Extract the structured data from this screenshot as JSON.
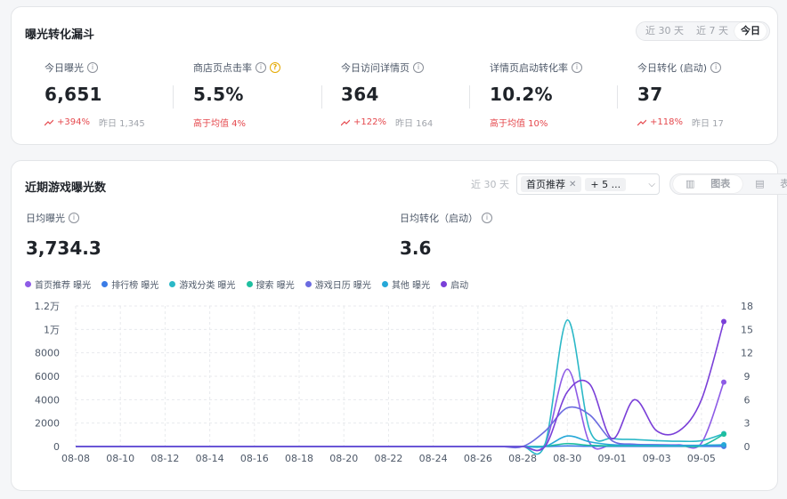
{
  "funnel": {
    "title": "曝光转化漏斗",
    "ranges": [
      "近 30 天",
      "近 7 天",
      "今日"
    ],
    "active_range": 2,
    "kpis": [
      {
        "label": "今日曝光",
        "value": "6,651",
        "change": "+394%",
        "compare": "昨日 1,345",
        "help": false
      },
      {
        "label": "商店页点击率",
        "value": "5.5%",
        "change": "高于均值 4%",
        "compare": "",
        "help": true
      },
      {
        "label": "今日访问详情页",
        "value": "364",
        "change": "+122%",
        "compare": "昨日 164",
        "help": false
      },
      {
        "label": "详情页启动转化率",
        "value": "10.2%",
        "change": "高于均值 10%",
        "compare": "",
        "help": false
      },
      {
        "label": "今日转化 (启动)",
        "value": "37",
        "change": "+118%",
        "compare": "昨日 17",
        "help": false
      }
    ]
  },
  "trend": {
    "title": "近期游戏曝光数",
    "range_label": "近 30 天",
    "filter_chip": "首页推荐",
    "filter_more": "+ 5 ...",
    "view_chart": "图表",
    "view_table": "表格",
    "avg_exposure_label": "日均曝光",
    "avg_exposure_value": "3,734.3",
    "avg_conv_label": "日均转化（启动）",
    "avg_conv_value": "3.6"
  },
  "colors": {
    "accent_up": "#e5484d"
  },
  "chart_data": {
    "type": "line",
    "x": [
      "08-08",
      "08-09",
      "08-10",
      "08-11",
      "08-12",
      "08-13",
      "08-14",
      "08-15",
      "08-16",
      "08-17",
      "08-18",
      "08-19",
      "08-20",
      "08-21",
      "08-22",
      "08-23",
      "08-24",
      "08-25",
      "08-26",
      "08-27",
      "08-28",
      "08-29",
      "08-30",
      "08-31",
      "09-01",
      "09-02",
      "09-03",
      "09-04",
      "09-05",
      "09-06"
    ],
    "xticks": [
      "08-08",
      "08-10",
      "08-12",
      "08-14",
      "08-16",
      "08-18",
      "08-20",
      "08-22",
      "08-24",
      "08-26",
      "08-28",
      "08-30",
      "09-01",
      "09-03",
      "09-05"
    ],
    "ylim": [
      0,
      12000
    ],
    "yticks": [
      0,
      2000,
      4000,
      6000,
      8000,
      10000,
      12000
    ],
    "ytick_labels": [
      "0",
      "2000",
      "4000",
      "6000",
      "8000",
      "1万",
      "1.2万"
    ],
    "y2lim": [
      0,
      18
    ],
    "y2ticks": [
      0,
      3,
      6,
      9,
      12,
      15,
      18
    ],
    "grid": true,
    "legend_position": "top-left",
    "series": [
      {
        "name": "首页推荐 曝光",
        "color": "#8e5ce6",
        "axis": "left",
        "values": [
          0,
          0,
          0,
          0,
          0,
          0,
          0,
          0,
          0,
          0,
          0,
          0,
          0,
          0,
          0,
          0,
          0,
          0,
          0,
          0,
          0,
          200,
          6600,
          300,
          150,
          150,
          150,
          150,
          300,
          5500
        ]
      },
      {
        "name": "排行榜 曝光",
        "color": "#3b7ce6",
        "axis": "left",
        "values": [
          0,
          0,
          0,
          0,
          0,
          0,
          0,
          0,
          0,
          0,
          0,
          0,
          0,
          0,
          0,
          0,
          0,
          0,
          0,
          0,
          0,
          0,
          50,
          20,
          10,
          10,
          10,
          10,
          10,
          10
        ]
      },
      {
        "name": "游戏分类 曝光",
        "color": "#2bb8c7",
        "axis": "left",
        "values": [
          0,
          0,
          0,
          0,
          0,
          0,
          0,
          0,
          0,
          0,
          0,
          0,
          0,
          0,
          0,
          0,
          0,
          0,
          0,
          0,
          0,
          200,
          10800,
          1400,
          700,
          600,
          500,
          450,
          500,
          1100
        ]
      },
      {
        "name": "搜索 曝光",
        "color": "#1fbfa0",
        "axis": "left",
        "values": [
          0,
          0,
          0,
          0,
          0,
          0,
          0,
          0,
          0,
          0,
          0,
          0,
          0,
          0,
          0,
          0,
          0,
          0,
          0,
          0,
          0,
          20,
          250,
          100,
          60,
          60,
          60,
          50,
          60,
          1050
        ]
      },
      {
        "name": "游戏日历 曝光",
        "color": "#6b6be0",
        "axis": "left",
        "values": [
          0,
          0,
          0,
          0,
          0,
          0,
          0,
          0,
          0,
          0,
          0,
          0,
          0,
          0,
          0,
          0,
          0,
          0,
          0,
          0,
          0,
          1300,
          3300,
          2700,
          500,
          200,
          150,
          100,
          100,
          100
        ]
      },
      {
        "name": "其他 曝光",
        "color": "#26a8d8",
        "axis": "left",
        "values": [
          0,
          0,
          0,
          0,
          0,
          0,
          0,
          0,
          0,
          0,
          0,
          0,
          0,
          0,
          0,
          0,
          0,
          0,
          0,
          0,
          0,
          0,
          900,
          400,
          150,
          100,
          100,
          80,
          100,
          150
        ]
      },
      {
        "name": "启动",
        "color": "#7a3fd8",
        "axis": "right",
        "values": [
          0,
          0,
          0,
          0,
          0,
          0,
          0,
          0,
          0,
          0,
          0,
          0,
          0,
          0,
          0,
          0,
          0,
          0,
          0,
          0,
          0,
          0,
          7,
          8,
          1,
          6,
          2,
          2,
          6,
          16
        ]
      }
    ]
  }
}
